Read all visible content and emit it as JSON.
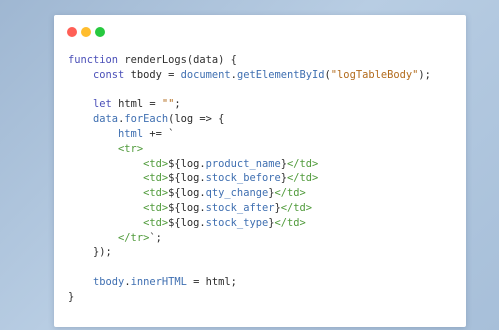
{
  "window": {
    "dots": [
      {
        "name": "close-dot",
        "color": "#ff5f56"
      },
      {
        "name": "minimize-dot",
        "color": "#ffbd2e"
      },
      {
        "name": "maximize-dot",
        "color": "#27c93f"
      }
    ]
  },
  "code": {
    "lines": [
      [
        {
          "c": "kw",
          "t": "function "
        },
        {
          "c": "fn",
          "t": "renderLogs(data) {"
        }
      ],
      [
        {
          "c": "op",
          "t": "    "
        },
        {
          "c": "kw",
          "t": "const "
        },
        {
          "c": "op",
          "t": "tbody = "
        },
        {
          "c": "prop",
          "t": "document"
        },
        {
          "c": "op",
          "t": "."
        },
        {
          "c": "prop",
          "t": "getElementById"
        },
        {
          "c": "op",
          "t": "("
        },
        {
          "c": "str",
          "t": "\"logTableBody\""
        },
        {
          "c": "op",
          "t": ");"
        }
      ],
      [
        {
          "c": "op",
          "t": ""
        }
      ],
      [
        {
          "c": "op",
          "t": "    "
        },
        {
          "c": "kw",
          "t": "let "
        },
        {
          "c": "op",
          "t": "html = "
        },
        {
          "c": "str",
          "t": "\"\""
        },
        {
          "c": "op",
          "t": ";"
        }
      ],
      [
        {
          "c": "op",
          "t": "    "
        },
        {
          "c": "prop",
          "t": "data"
        },
        {
          "c": "op",
          "t": "."
        },
        {
          "c": "prop",
          "t": "forEach"
        },
        {
          "c": "op",
          "t": "(log => {"
        }
      ],
      [
        {
          "c": "op",
          "t": "        "
        },
        {
          "c": "var",
          "t": "html"
        },
        {
          "c": "op",
          "t": " += `"
        }
      ],
      [
        {
          "c": "op",
          "t": "        "
        },
        {
          "c": "tag",
          "t": "<tr>"
        }
      ],
      [
        {
          "c": "op",
          "t": "            "
        },
        {
          "c": "tag",
          "t": "<td>"
        },
        {
          "c": "tmpl",
          "t": "${log."
        },
        {
          "c": "prop",
          "t": "product_name"
        },
        {
          "c": "tmpl",
          "t": "}"
        },
        {
          "c": "tag",
          "t": "</td>"
        }
      ],
      [
        {
          "c": "op",
          "t": "            "
        },
        {
          "c": "tag",
          "t": "<td>"
        },
        {
          "c": "tmpl",
          "t": "${log."
        },
        {
          "c": "prop",
          "t": "stock_before"
        },
        {
          "c": "tmpl",
          "t": "}"
        },
        {
          "c": "tag",
          "t": "</td>"
        }
      ],
      [
        {
          "c": "op",
          "t": "            "
        },
        {
          "c": "tag",
          "t": "<td>"
        },
        {
          "c": "tmpl",
          "t": "${log."
        },
        {
          "c": "prop",
          "t": "qty_change"
        },
        {
          "c": "tmpl",
          "t": "}"
        },
        {
          "c": "tag",
          "t": "</td>"
        }
      ],
      [
        {
          "c": "op",
          "t": "            "
        },
        {
          "c": "tag",
          "t": "<td>"
        },
        {
          "c": "tmpl",
          "t": "${log."
        },
        {
          "c": "prop",
          "t": "stock_after"
        },
        {
          "c": "tmpl",
          "t": "}"
        },
        {
          "c": "tag",
          "t": "</td>"
        }
      ],
      [
        {
          "c": "op",
          "t": "            "
        },
        {
          "c": "tag",
          "t": "<td>"
        },
        {
          "c": "tmpl",
          "t": "${log."
        },
        {
          "c": "prop",
          "t": "stock_type"
        },
        {
          "c": "tmpl",
          "t": "}"
        },
        {
          "c": "tag",
          "t": "</td>"
        }
      ],
      [
        {
          "c": "op",
          "t": "        "
        },
        {
          "c": "tag",
          "t": "</tr>"
        },
        {
          "c": "op",
          "t": "`;"
        }
      ],
      [
        {
          "c": "op",
          "t": "    });"
        }
      ],
      [
        {
          "c": "op",
          "t": ""
        }
      ],
      [
        {
          "c": "op",
          "t": "    "
        },
        {
          "c": "var",
          "t": "tbody"
        },
        {
          "c": "op",
          "t": "."
        },
        {
          "c": "prop",
          "t": "innerHTML"
        },
        {
          "c": "op",
          "t": " = html;"
        }
      ],
      [
        {
          "c": "op",
          "t": "}"
        }
      ]
    ]
  }
}
